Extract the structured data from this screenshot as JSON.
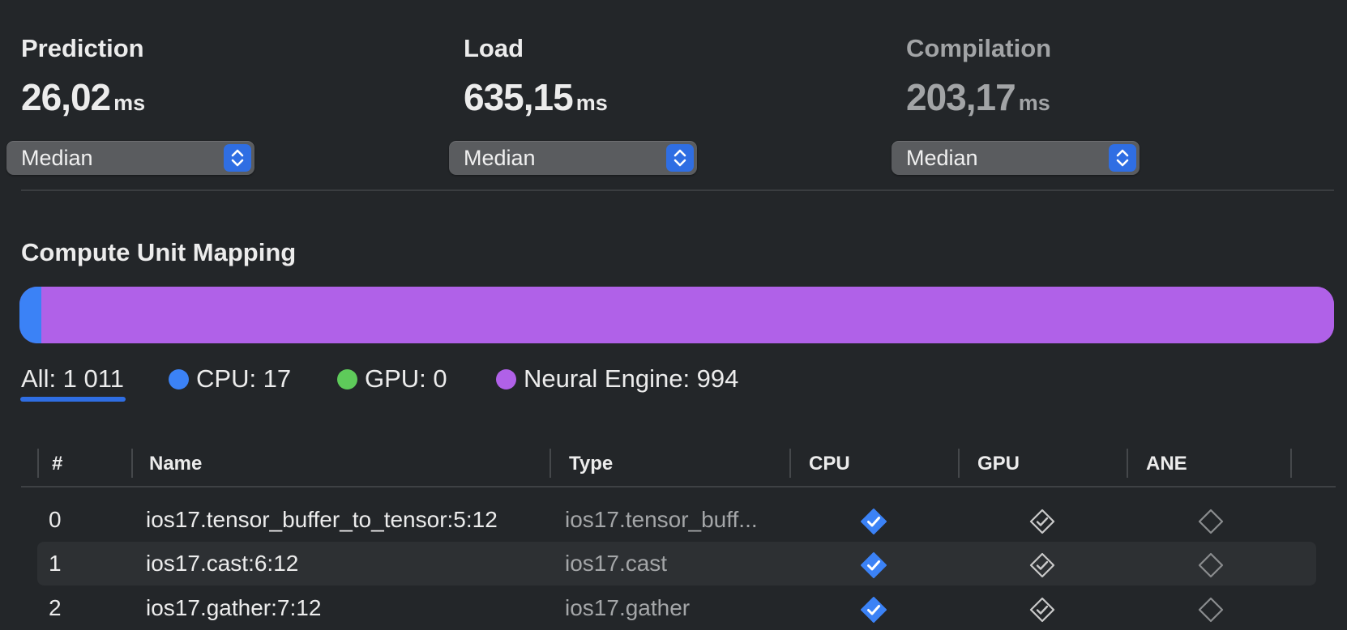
{
  "metrics": [
    {
      "title": "Prediction",
      "value": "26,02",
      "unit": "ms",
      "aggregation": "Median"
    },
    {
      "title": "Load",
      "value": "635,15",
      "unit": "ms",
      "aggregation": "Median"
    },
    {
      "title": "Compilation",
      "value": "203,17",
      "unit": "ms",
      "aggregation": "Median"
    }
  ],
  "mapping": {
    "title": "Compute Unit Mapping",
    "total": 1011,
    "units": [
      {
        "name": "CPU",
        "count": 17,
        "color": "#3b82f6"
      },
      {
        "name": "GPU",
        "count": 0,
        "color": "#5ecb5a"
      },
      {
        "name": "Neural Engine",
        "count": 994,
        "color": "#b061e8"
      }
    ],
    "filters": {
      "all": "All: 1 011",
      "cpu": "CPU: 17",
      "gpu": "GPU: 0",
      "ane": "Neural Engine: 994",
      "selected": "All: 1 011"
    }
  },
  "table": {
    "columns": [
      "#",
      "Name",
      "Type",
      "CPU",
      "GPU",
      "ANE"
    ],
    "rows": [
      {
        "index": "0",
        "name": "ios17.tensor_buffer_to_tensor:5:12",
        "type": "ios17.tensor_buff...",
        "cpu": "selected",
        "gpu": "supported",
        "ane": "unsupported"
      },
      {
        "index": "1",
        "name": "ios17.cast:6:12",
        "type": "ios17.cast",
        "cpu": "selected",
        "gpu": "supported",
        "ane": "unsupported"
      },
      {
        "index": "2",
        "name": "ios17.gather:7:12",
        "type": "ios17.gather",
        "cpu": "selected",
        "gpu": "supported",
        "ane": "unsupported"
      }
    ]
  },
  "colors": {
    "accent": "#2f6ee3",
    "background": "#232629"
  }
}
